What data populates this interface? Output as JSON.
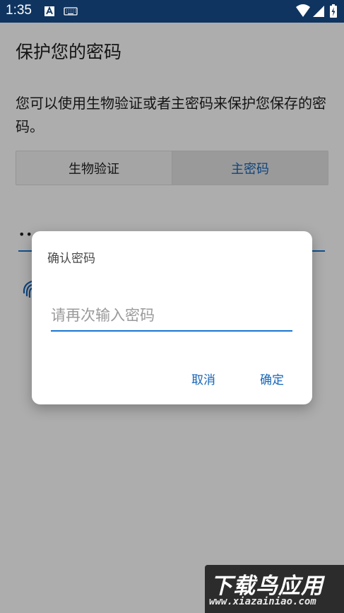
{
  "status_bar": {
    "time": "1:35",
    "icons": [
      "notification-a-icon",
      "keyboard-icon",
      "wifi-icon",
      "signal-icon",
      "battery-charging-icon"
    ]
  },
  "page": {
    "title": "保护您的密码",
    "description": "您可以使用生物验证或者主密码来保护您保存的密码。",
    "tabs": [
      {
        "label": "生物验证",
        "selected": false
      },
      {
        "label": "主密码",
        "selected": true
      }
    ],
    "password_masked": "••",
    "fingerprint_icon": "fingerprint-icon"
  },
  "dialog": {
    "title": "确认密码",
    "input_placeholder": "请再次输入密码",
    "input_value": "",
    "cancel_label": "取消",
    "confirm_label": "确定"
  },
  "watermark": {
    "title": "下载鸟应用",
    "url": "www.xiazainiao.com"
  },
  "colors": {
    "status_bar": "#0f3460",
    "accent": "#1565b8",
    "underline": "#1976d2"
  }
}
